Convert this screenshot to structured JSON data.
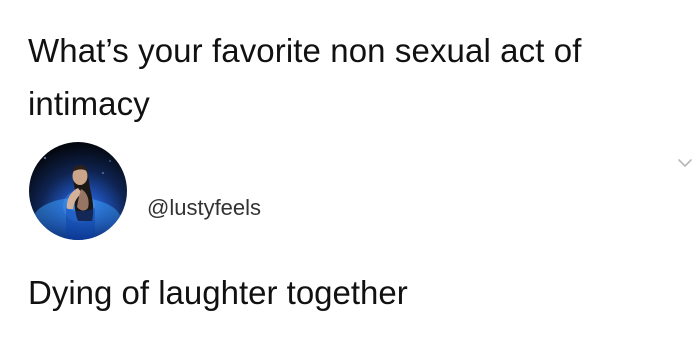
{
  "post": {
    "question": "What’s your favorite non sexual act of intimacy",
    "reply": {
      "handle": "@lustyfeels",
      "text": "Dying of laughter together"
    }
  },
  "icons": {
    "avatar": "profile-photo-avatar",
    "chevron": "chevron-down-icon"
  },
  "colors": {
    "background": "#ffffff",
    "text": "#111111",
    "handle": "#333333",
    "chevron": "#b8b8b8",
    "avatar_bg": "#0b1a3a"
  }
}
